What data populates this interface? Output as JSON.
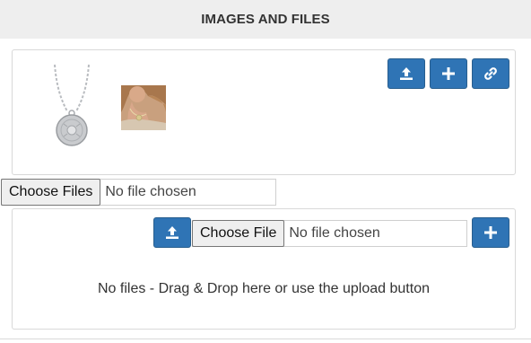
{
  "section": {
    "title": "IMAGES AND FILES"
  },
  "images_panel": {
    "thumbnails": [
      {
        "icon": "necklace-thumbnail"
      },
      {
        "icon": "model-wearing-necklace-thumbnail"
      }
    ],
    "actions": [
      {
        "icon": "upload-icon"
      },
      {
        "icon": "plus-icon"
      },
      {
        "icon": "link-icon"
      }
    ]
  },
  "images_file_input": {
    "button_label": "Choose Files",
    "status": "No file chosen"
  },
  "files_panel": {
    "file_input": {
      "button_label": "Choose File",
      "status": "No file chosen"
    },
    "actions": [
      {
        "icon": "upload-icon"
      },
      {
        "icon": "plus-icon"
      }
    ],
    "empty_message": "No files - Drag & Drop here or use the upload button"
  },
  "colors": {
    "accent": "#2f74b5",
    "header_bg": "#eeeeee",
    "border": "#d9d9d9"
  }
}
